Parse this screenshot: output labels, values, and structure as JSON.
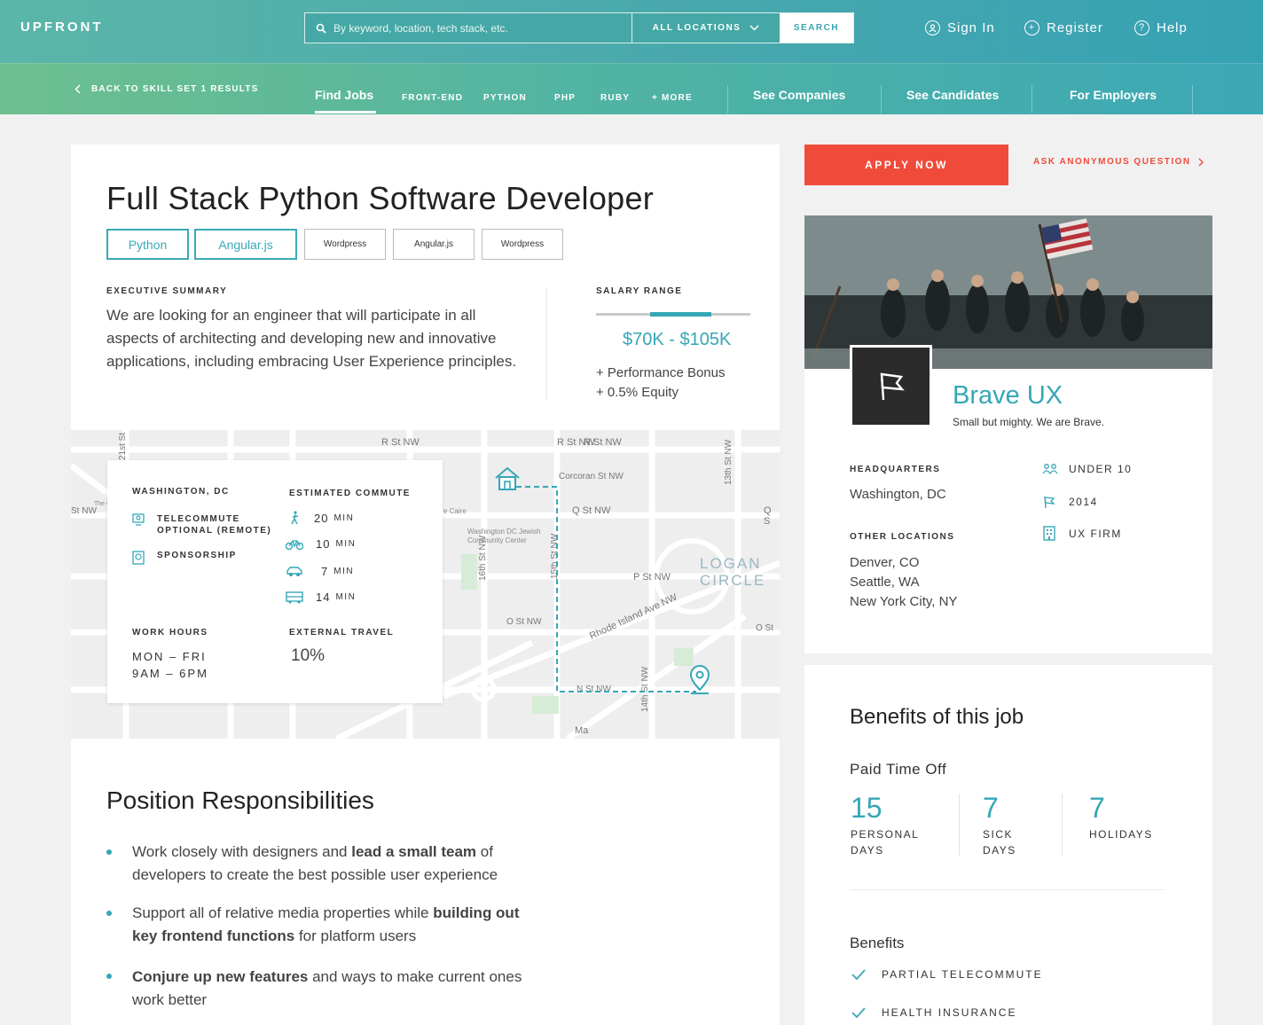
{
  "header": {
    "logo": "UPFRONT",
    "search_placeholder": "By keyword, location, tech stack, etc.",
    "location_select": "ALL LOCATIONS",
    "search_button": "SEARCH",
    "sign_in": "Sign In",
    "register": "Register",
    "help": "Help"
  },
  "subnav": {
    "back": "BACK TO SKILL SET 1 RESULTS",
    "find_jobs": "Find Jobs",
    "filters": [
      "FRONT-END",
      "PYTHON",
      "PHP",
      "RUBY",
      "+ MORE"
    ],
    "see_companies": "See Companies",
    "see_candidates": "See Candidates",
    "for_employers": "For Employers"
  },
  "job": {
    "title": "Full Stack Python Software Developer",
    "tags": [
      "Python",
      "Angular.js",
      "Wordpress",
      "Angular.js",
      "Wordpress"
    ],
    "summary_label": "EXECUTIVE SUMMARY",
    "summary_lines": [
      "We are looking for an engineer that will participate in all",
      "aspects of architecting and developing new and innovative",
      "applications, including embracing User Experience principles."
    ],
    "salary_label": "SALARY RANGE",
    "salary": "$70K - $105K",
    "salary_range_fraction": [
      0.35,
      0.75
    ],
    "perks": [
      "+ Performance Bonus",
      "+ 0.5% Equity"
    ]
  },
  "map": {
    "streets": [
      "R St NW",
      "R St NW",
      "R St NW",
      "Corcoran St NW",
      "Q St NW",
      "P St NW",
      "O St NW",
      "N St NW",
      "Rhode Island Ave NW",
      "13th St NW",
      "14th St NW",
      "15th St NW",
      "16th St NW",
      "21st St",
      "Ma",
      "LOGAN",
      "CIRCLE",
      "Washington DC Jewish Community Center",
      "e Caire",
      "O St",
      "Q S",
      "St NW",
      "The Ce"
    ],
    "card": {
      "city": "WASHINGTON, DC",
      "features": [
        "TELECOMMUTE OPTIONAL (REMOTE)",
        "SPONSORSHIP"
      ],
      "commute_label": "ESTIMATED COMMUTE",
      "commute": [
        {
          "mode": "walk-icon",
          "time": "20",
          "unit": "MIN"
        },
        {
          "mode": "bike-icon",
          "time": "10",
          "unit": "MIN"
        },
        {
          "mode": "car-icon",
          "time": "7",
          "unit": "MIN"
        },
        {
          "mode": "bus-icon",
          "time": "14",
          "unit": "MIN"
        }
      ],
      "hours_label": "WORK HOURS",
      "hours": [
        "MON – FRI",
        "9AM – 6PM"
      ],
      "travel_label": "EXTERNAL TRAVEL",
      "travel": "10%"
    }
  },
  "responsibilities": {
    "title": "Position Responsibilities",
    "items": [
      {
        "a": "Work closely with designers and ",
        "b": "lead a small team",
        "c": " of",
        "d": "developers to create the best possible user experience"
      },
      {
        "a": "Support all of relative media properties while ",
        "b": "building out",
        "c": "",
        "d2b": "key frontend functions",
        "d": " for platform users"
      },
      {
        "a": "",
        "b": "Conjure up new features",
        "c": " and ways to make current ones",
        "d": "work better"
      }
    ]
  },
  "sidebar": {
    "apply": "APPLY NOW",
    "ask": "ASK ANONYMOUS QUESTION",
    "company": "Brave UX",
    "tagline": "Small but mighty. We are Brave.",
    "hq_label": "HEADQUARTERS",
    "hq": "Washington, DC",
    "other_label": "OTHER LOCATIONS",
    "other": [
      "Denver, CO",
      "Seattle, WA",
      "New York City, NY"
    ],
    "facts": [
      "UNDER 10",
      "2014",
      "UX FIRM"
    ]
  },
  "benefits": {
    "title": "Benefits of this job",
    "pto_label": "Paid Time Off",
    "pto": [
      {
        "num": "15",
        "l1": "PERSONAL",
        "l2": "DAYS"
      },
      {
        "num": "7",
        "l1": "SICK",
        "l2": "DAYS"
      },
      {
        "num": "7",
        "l1": "HOLIDAYS",
        "l2": ""
      }
    ],
    "list_label": "Benefits",
    "list": [
      "PARTIAL TELECOMMUTE",
      "HEALTH INSURANCE"
    ]
  },
  "colors": {
    "teal": "#35a7b7",
    "apply": "#f04b3a",
    "dark": "#2b2b2b"
  }
}
